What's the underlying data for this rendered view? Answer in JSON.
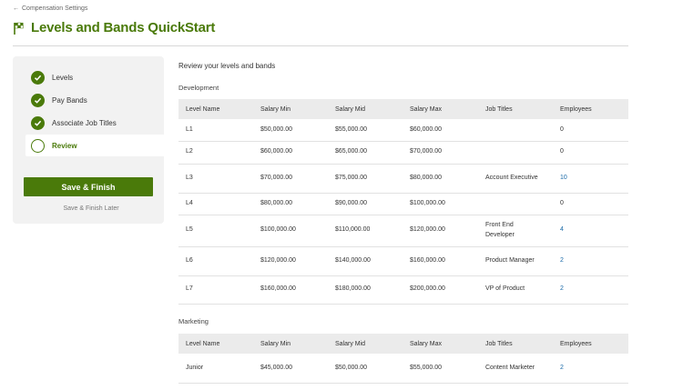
{
  "breadcrumb": {
    "label": "Compensation Settings"
  },
  "page": {
    "title": "Levels and Bands QuickStart"
  },
  "stepper": {
    "steps": [
      {
        "label": "Levels",
        "state": "done"
      },
      {
        "label": "Pay Bands",
        "state": "done"
      },
      {
        "label": "Associate Job Titles",
        "state": "done"
      },
      {
        "label": "Review",
        "state": "current"
      }
    ],
    "save_label": "Save & Finish",
    "later_label": "Save & Finish Later"
  },
  "review": {
    "heading": "Review your levels and bands"
  },
  "columns": [
    "Level Name",
    "Salary Min",
    "Salary Mid",
    "Salary Max",
    "Job Titles",
    "Employees"
  ],
  "groups": [
    {
      "name": "Development",
      "rows": [
        {
          "level": "L1",
          "min": "$50,000.00",
          "mid": "$55,000.00",
          "max": "$60,000.00",
          "titles": "",
          "employees": "0"
        },
        {
          "level": "L2",
          "min": "$60,000.00",
          "mid": "$65,000.00",
          "max": "$70,000.00",
          "titles": "",
          "employees": "0"
        },
        {
          "level": "L3",
          "min": "$70,000.00",
          "mid": "$75,000.00",
          "max": "$80,000.00",
          "titles": "Account Executive",
          "employees": "10"
        },
        {
          "level": "L4",
          "min": "$80,000.00",
          "mid": "$90,000.00",
          "max": "$100,000.00",
          "titles": "",
          "employees": "0"
        },
        {
          "level": "L5",
          "min": "$100,000.00",
          "mid": "$110,000.00",
          "max": "$120,000.00",
          "titles": "Front End Developer",
          "employees": "4"
        },
        {
          "level": "L6",
          "min": "$120,000.00",
          "mid": "$140,000.00",
          "max": "$160,000.00",
          "titles": "Product Manager",
          "employees": "2"
        },
        {
          "level": "L7",
          "min": "$160,000.00",
          "mid": "$180,000.00",
          "max": "$200,000.00",
          "titles": "VP of Product",
          "employees": "2"
        }
      ]
    },
    {
      "name": "Marketing",
      "rows": [
        {
          "level": "Junior",
          "min": "$45,000.00",
          "mid": "$50,000.00",
          "max": "$55,000.00",
          "titles": "Content Marketer",
          "employees": "2"
        }
      ]
    }
  ],
  "colors": {
    "accent": "#4a7a0a",
    "link": "#1a6aa8",
    "panel": "#f2f2f2",
    "header_row": "#ebebeb"
  }
}
